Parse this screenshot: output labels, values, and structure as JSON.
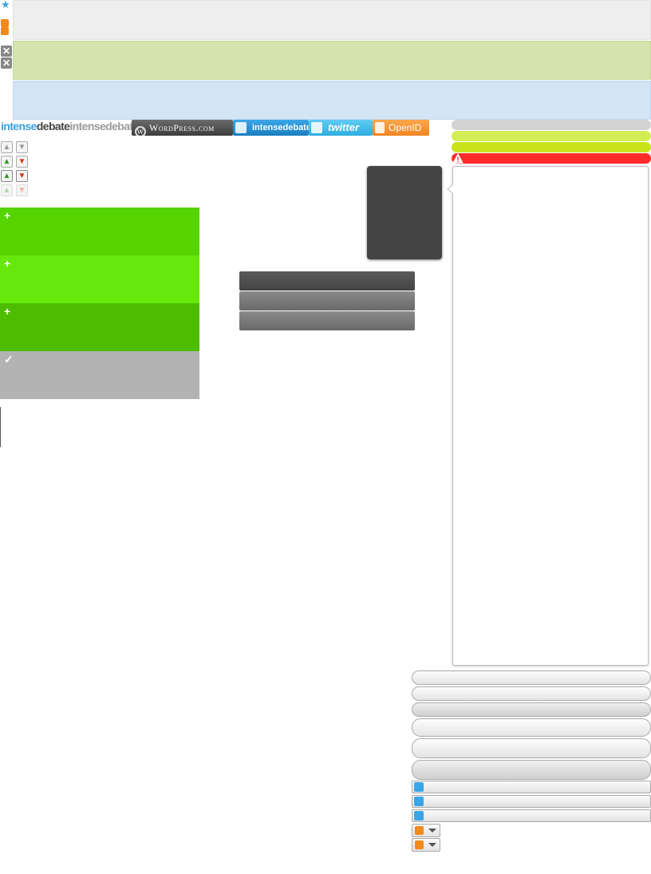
{
  "logo": {
    "part1": "intense",
    "part2": "debate",
    "part3": "intensedebate"
  },
  "login_buttons": {
    "wordpress": "WordPress.com",
    "intensedebate": "intensedebate",
    "twitter": "twitter",
    "openid": "OpenID"
  },
  "icons": {
    "plus": "+",
    "check": "✓",
    "close": "✕",
    "warning": "!"
  },
  "colors": {
    "green_1": "#55d400",
    "green_2": "#66e80c",
    "green_3": "#4dbd00",
    "gray_panel": "#b3b3b3",
    "status_gray": "#d3d3d3",
    "status_lime": "#d4ec55",
    "status_yellowgreen": "#c9e31a",
    "status_red": "#ff2b2b"
  }
}
